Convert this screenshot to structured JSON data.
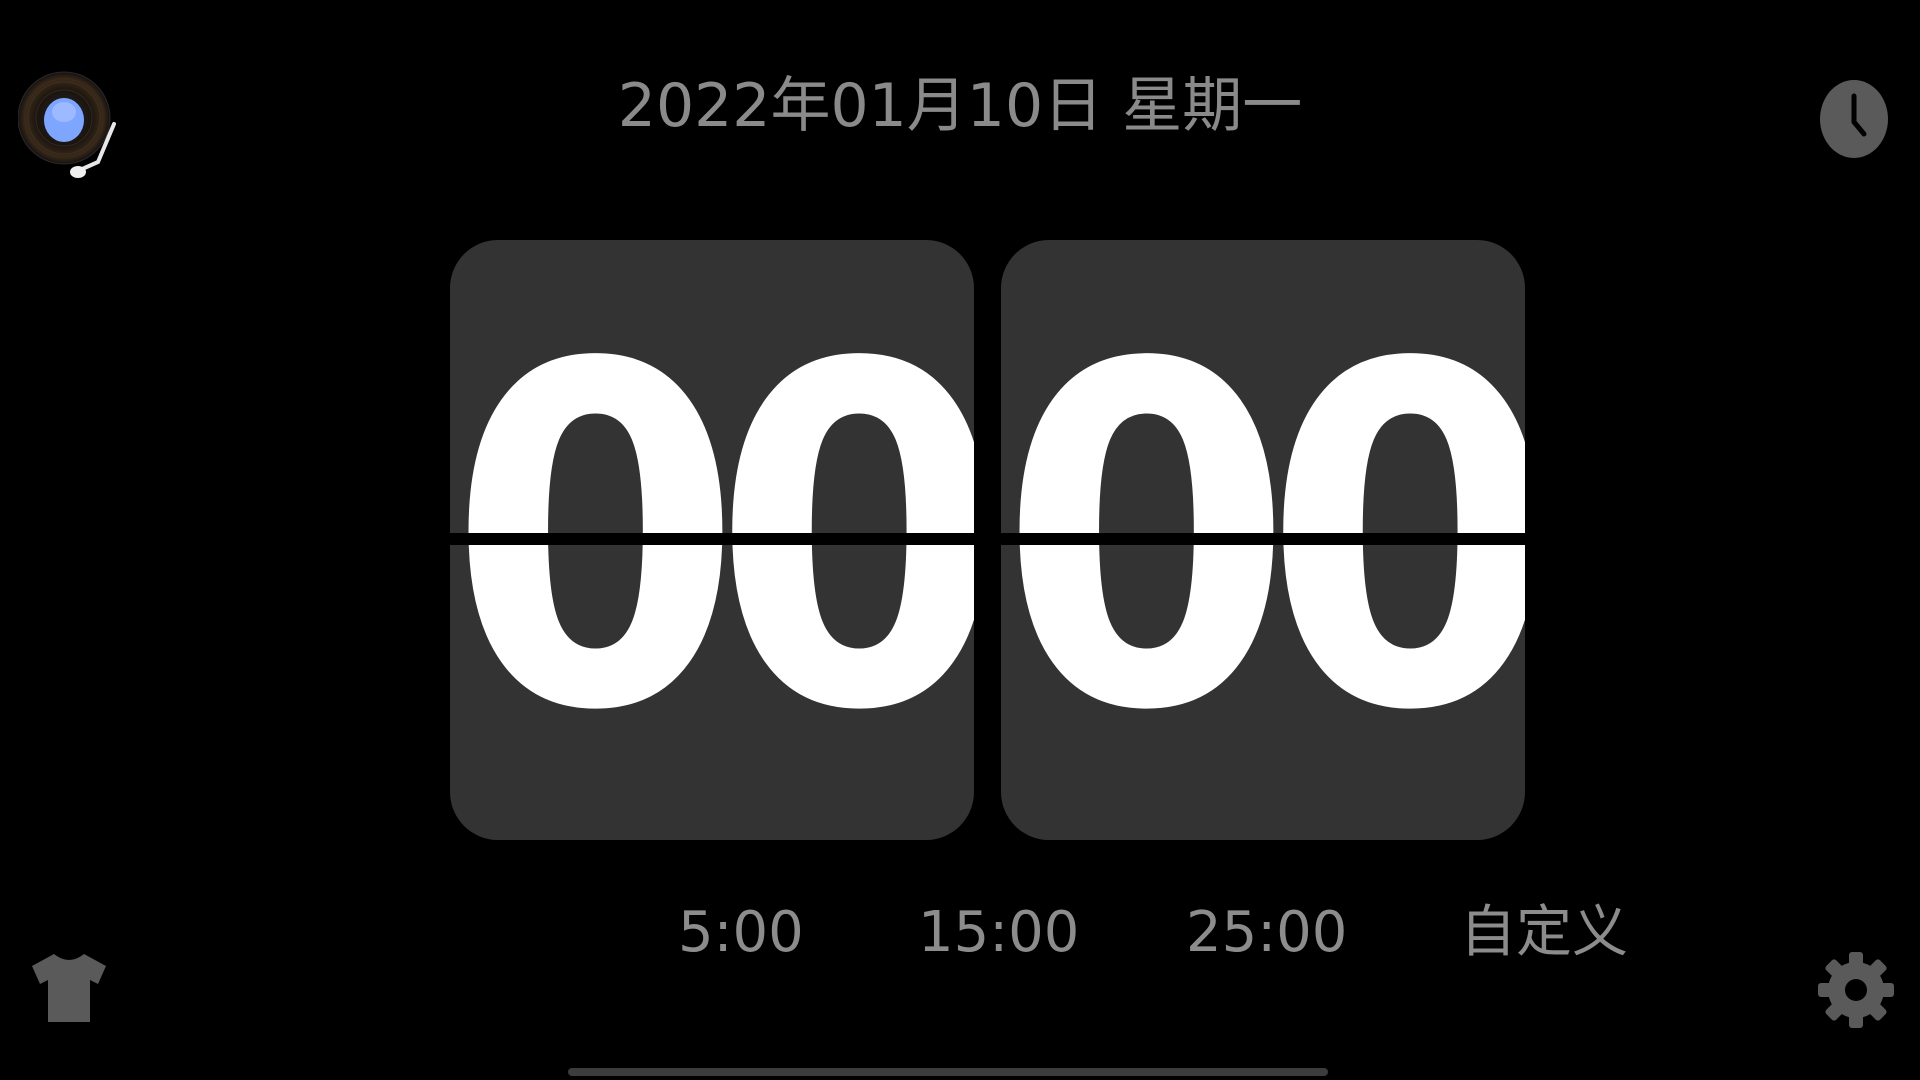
{
  "header": {
    "date_text": "2022年01月10日 星期一"
  },
  "clock": {
    "hours": "00",
    "minutes": "00"
  },
  "presets": [
    {
      "label": "5:00"
    },
    {
      "label": "15:00"
    },
    {
      "label": "25:00"
    },
    {
      "label": "自定义"
    }
  ],
  "icons": {
    "top_left": "vinyl-record-player-icon",
    "top_right": "clock-icon",
    "bottom_left": "tshirt-icon",
    "bottom_right": "gear-icon"
  },
  "colors": {
    "background": "#000000",
    "card": "#333333",
    "digit": "#ffffff",
    "muted_text": "#8c8c8c",
    "icon_gray": "#5a5a5a",
    "vinyl_accent": "#7fa6ff"
  }
}
